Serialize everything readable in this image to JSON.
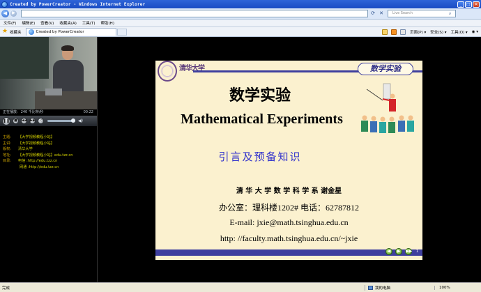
{
  "window": {
    "title": "Created by PowerCreator - Windows Internet Explorer",
    "minimize_glyph": "_",
    "maximize_glyph": "□",
    "close_glyph": "✕"
  },
  "address_bar": {
    "url": "",
    "search_placeholder": "Live Search",
    "back_glyph": "◀",
    "forward_glyph": "▶",
    "refresh_glyph": "⟳",
    "stop_glyph": "✕",
    "search_go_glyph": "⌕"
  },
  "menu": [
    "文件(F)",
    "编辑(E)",
    "查看(V)",
    "收藏夹(A)",
    "工具(T)",
    "帮助(H)"
  ],
  "favorites": {
    "label": "收藏夹",
    "tab_title": "Created by PowerCreator"
  },
  "commands": {
    "page": "页面(P) ▾",
    "safety": "安全(S) ▾",
    "tools": "工具(O) ▾",
    "help": "◉ ▾"
  },
  "player": {
    "status": "正在播放:",
    "bitrate": "240 千比特/秒",
    "time": "00:22",
    "play_glyph": "❚❚",
    "stop_glyph": "■",
    "prev_glyph": "◀◀",
    "next_glyph": "▶▶",
    "mute_glyph": "◁",
    "volume_glyph": "◀)"
  },
  "info": [
    {
      "key": "主题:",
      "value": "【大学视频教程小站】"
    },
    {
      "key": "主讲:",
      "value": "【大学视频教程小站】"
    },
    {
      "key": "版权:",
      "value": "清华大学"
    },
    {
      "key": "地址:",
      "value": "【大学视频教程小站】edu.tzz.cn"
    },
    {
      "key": "目录:",
      "value": "电信 :http://edu.tzz.cn"
    }
  ],
  "info_extra": "网通 :http://edu.tzz.cn",
  "slide": {
    "seal_text": "清华大学",
    "badge": "数学实验",
    "title_cn": "数学实验",
    "title_en": "Mathematical Experiments",
    "intro": "引言及预备知识",
    "author": "清 华 大 学 数 学 科 学 系    谢金星",
    "office": "办公室：理科楼1202#   电话：62787812",
    "email": "E-mail: jxie@math.tsinghua.edu.cn",
    "url": "http: //faculty.math.tsinghua.edu.cn/~jxie",
    "prev_glyph": "◀",
    "next_glyph": "▶",
    "end_glyph": "▶▶",
    "page": "1"
  },
  "statusbar": {
    "text": "完成",
    "zone": "我的电脑",
    "zoom": "100%"
  },
  "colors": {
    "accent": "#3e3f9e",
    "slide_bg": "#fbf1cf",
    "info_text": "#d4d100",
    "intro_text": "#3333cc"
  }
}
